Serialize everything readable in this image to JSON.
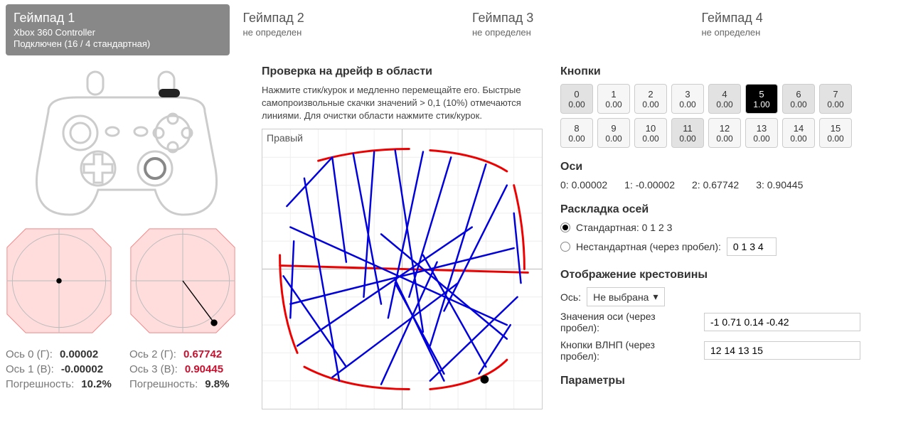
{
  "tabs": [
    {
      "title": "Геймпад 1",
      "sub1": "Xbox 360 Controller",
      "sub2": "Подключен (16 / 4 стандартная)"
    },
    {
      "title": "Геймпад 2",
      "sub1": "не определен"
    },
    {
      "title": "Геймпад 3",
      "sub1": "не определен"
    },
    {
      "title": "Геймпад 4",
      "sub1": "не определен"
    }
  ],
  "left": {
    "stick0": {
      "axis_h_label": "Ось 0 (Г):",
      "axis_h_val": "0.00002",
      "axis_v_label": "Ось 1 (В):",
      "axis_v_val": "-0.00002",
      "err_label": "Погрешность:",
      "err_val": "10.2%"
    },
    "stick1": {
      "axis_h_label": "Ось 2 (Г):",
      "axis_h_val": "0.67742",
      "axis_v_label": "Ось 3 (В):",
      "axis_v_val": "0.90445",
      "err_label": "Погрешность:",
      "err_val": "9.8%"
    }
  },
  "mid": {
    "heading": "Проверка на дрейф в области",
    "help": "Нажмите стик/курок и медленно перемещайте его. Быстрые самопроизвольные скачки значений > 0,1 (10%) отмечаются линиями. Для очистки области нажмите стик/курок.",
    "box_label": "Правый"
  },
  "right": {
    "buttons_heading": "Кнопки",
    "buttons": [
      {
        "n": "0",
        "v": "0.00",
        "gray": true
      },
      {
        "n": "1",
        "v": "0.00"
      },
      {
        "n": "2",
        "v": "0.00"
      },
      {
        "n": "3",
        "v": "0.00"
      },
      {
        "n": "4",
        "v": "0.00",
        "gray": true
      },
      {
        "n": "5",
        "v": "1.00",
        "on": true
      },
      {
        "n": "6",
        "v": "0.00",
        "gray": true
      },
      {
        "n": "7",
        "v": "0.00",
        "gray": true
      },
      {
        "n": "8",
        "v": "0.00"
      },
      {
        "n": "9",
        "v": "0.00"
      },
      {
        "n": "10",
        "v": "0.00"
      },
      {
        "n": "11",
        "v": "0.00",
        "gray": true
      },
      {
        "n": "12",
        "v": "0.00"
      },
      {
        "n": "13",
        "v": "0.00"
      },
      {
        "n": "14",
        "v": "0.00"
      },
      {
        "n": "15",
        "v": "0.00"
      }
    ],
    "axes_heading": "Оси",
    "axes": [
      {
        "label": "0:",
        "val": "0.00002"
      },
      {
        "label": "1:",
        "val": "-0.00002"
      },
      {
        "label": "2:",
        "val": "0.67742"
      },
      {
        "label": "3:",
        "val": "0.90445"
      }
    ],
    "layout_heading": "Раскладка осей",
    "layout_std": "Стандартная: 0 1 2 3",
    "layout_nonstd": "Нестандартная (через пробел):",
    "layout_nonstd_val": "0 1 3 4",
    "dpad_heading": "Отображение крестовины",
    "dpad_axis_label": "Ось:",
    "dpad_axis_val": "Не выбрана",
    "axis_values_label": "Значения оси (через пробел):",
    "axis_values_val": "-1 0.71 0.14 -0.42",
    "dpad_buttons_label": "Кнопки ВЛНП (через пробел):",
    "dpad_buttons_val": "12 14 13 15",
    "params_heading": "Параметры"
  }
}
